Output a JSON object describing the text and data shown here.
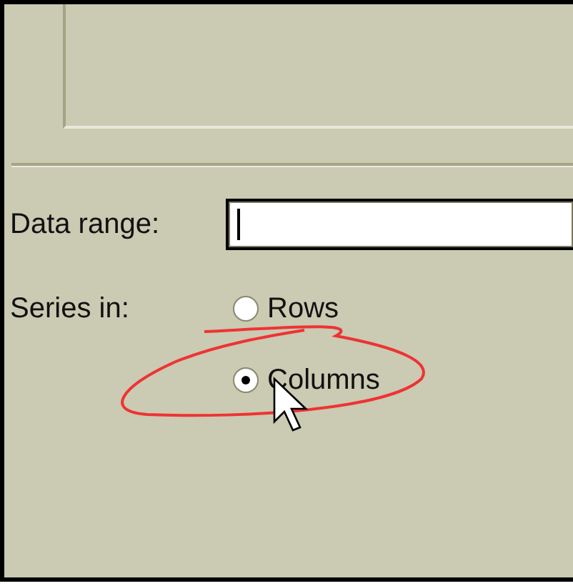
{
  "data_range": {
    "label": "Data range:"
  },
  "series_in": {
    "label": "Series in:",
    "options": [
      {
        "label": "Rows",
        "selected": false
      },
      {
        "label": "Columns",
        "selected": true
      }
    ]
  }
}
